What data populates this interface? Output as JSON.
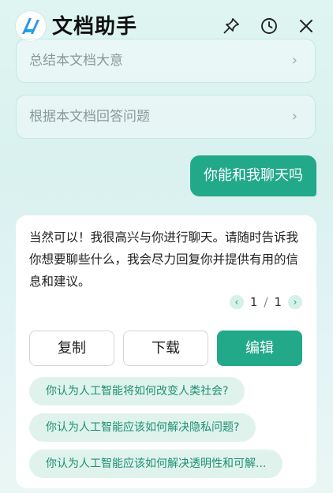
{
  "header": {
    "title": "文档助手",
    "icons": [
      "logo-icon",
      "pin-icon",
      "history-icon",
      "close-icon"
    ]
  },
  "suggestions": [
    "总结本文档大意",
    "根据本文档回答问题"
  ],
  "chevron": "›",
  "user_message": "你能和我聊天吗",
  "reply": {
    "text": "当然可以！我很高兴与你进行聊天。请随时告诉我你想要聊些什么，我会尽力回复你并提供有用的信息和建议。",
    "pager": {
      "prev": "‹",
      "current": "1",
      "separator": "/",
      "total": "1",
      "next": "›"
    },
    "actions": {
      "copy": "复制",
      "download": "下载",
      "edit": "编辑"
    }
  },
  "followups": [
    "你认为人工智能将如何改变人类社会?",
    "你认为人工智能应该如何解决隐私问题?",
    "你认为人工智能应该如何解决透明性和可解..."
  ],
  "colors": {
    "accent": "#21a98a",
    "chip_bg": "#dff3ec",
    "chip_text": "#1e8f73"
  }
}
